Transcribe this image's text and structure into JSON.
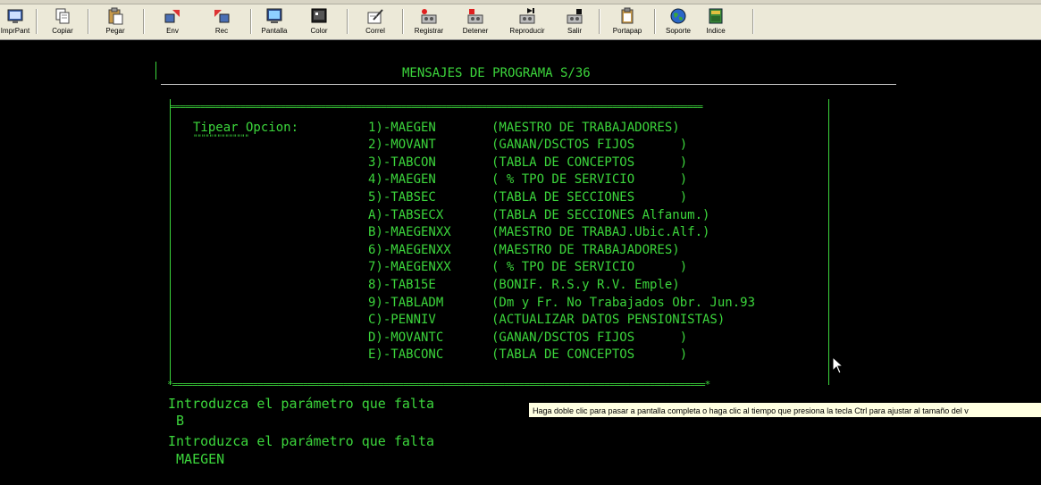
{
  "toolbar": {
    "buttons": [
      {
        "label": "ImprPant",
        "icon": "print-screen-icon"
      },
      {
        "label": "Copiar",
        "icon": "copy-icon"
      },
      {
        "label": "Pegar",
        "icon": "paste-icon"
      },
      {
        "label": "Env",
        "icon": "send-icon"
      },
      {
        "label": "Rec",
        "icon": "receive-icon"
      },
      {
        "label": "Pantalla",
        "icon": "screen-icon"
      },
      {
        "label": "Color",
        "icon": "color-icon"
      },
      {
        "label": "Correl",
        "icon": "edit-icon"
      },
      {
        "label": "Registrar",
        "icon": "record-icon"
      },
      {
        "label": "Detener",
        "icon": "stop-icon"
      },
      {
        "label": "Reproducir",
        "icon": "play-icon"
      },
      {
        "label": "Salir",
        "icon": "exit-icon"
      },
      {
        "label": "Portapap",
        "icon": "clipboard-icon"
      },
      {
        "label": "Soporte",
        "icon": "globe-icon"
      },
      {
        "label": "Indice",
        "icon": "book-icon"
      }
    ]
  },
  "terminal": {
    "title": "MENSAJES DE PROGRAMA S/36",
    "prompt_label": "Tipear Opcion:",
    "prompt_underline": "\"\"\"\"\"\"\"\"\"\"\"\"\"\"",
    "menu": [
      {
        "code": "1)-MAEGEN",
        "desc": "(MAESTRO DE TRABAJADORES)"
      },
      {
        "code": "2)-MOVANT",
        "desc": "(GANAN/DSCTOS FIJOS      )"
      },
      {
        "code": "3)-TABCON",
        "desc": "(TABLA DE CONCEPTOS      )"
      },
      {
        "code": "4)-MAEGEN",
        "desc": "( % TPO DE SERVICIO      )"
      },
      {
        "code": "5)-TABSEC",
        "desc": "(TABLA DE SECCIONES      )"
      },
      {
        "code": "A)-TABSECX",
        "desc": "(TABLA DE SECCIONES Alfanum.)"
      },
      {
        "code": "B)-MAEGENXX",
        "desc": "(MAESTRO DE TRABAJ.Ubic.Alf.)"
      },
      {
        "code": "6)-MAEGENXX",
        "desc": "(MAESTRO DE TRABAJADORES)"
      },
      {
        "code": "7)-MAEGENXX",
        "desc": "( % TPO DE SERVICIO      )"
      },
      {
        "code": "8)-TAB15E",
        "desc": "(BONIF. R.S.y R.V. Emple)"
      },
      {
        "code": "9)-TABLADM",
        "desc": "(Dm y Fr. No Trabajados Obr. Jun.93"
      },
      {
        "code": "C)-PENNIV",
        "desc": "(ACTUALIZAR DATOS PENSIONISTAS)"
      },
      {
        "code": "D)-MOVANTC",
        "desc": "(GANAN/DSCTOS FIJOS      )"
      },
      {
        "code": "E)-TABCONC",
        "desc": "(TABLA DE CONCEPTOS      )"
      }
    ],
    "messages": [
      {
        "text": "Introduzca el parámetro que falta",
        "value": " B"
      },
      {
        "text": "Introduzca el parámetro que falta",
        "value": " MAEGEN"
      }
    ]
  },
  "tooltip": "Haga doble clic para pasar a pantalla completa o haga clic al tiempo que presiona la tecla Ctrl para ajustar al tamaño del v"
}
